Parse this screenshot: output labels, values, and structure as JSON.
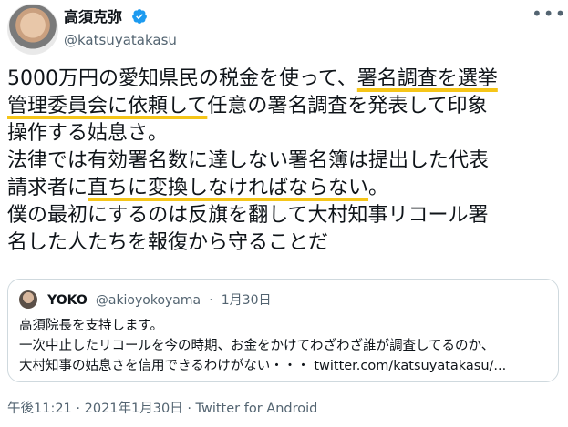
{
  "author": {
    "display_name": "高須克弥",
    "handle": "@katsuyatakasu",
    "verified": true
  },
  "tweet": {
    "lines": [
      [
        {
          "text": "5000万円の愛知県民の税金を使って、",
          "highlight": false
        },
        {
          "text": "署名調査を選挙",
          "highlight": true
        }
      ],
      [
        {
          "text": "管理委員会に依頼して",
          "highlight": true
        },
        {
          "text": "任意の署名調査を発表して印象",
          "highlight": false
        }
      ],
      [
        {
          "text": "操作する姑息さ。",
          "highlight": false
        }
      ],
      [
        {
          "text": "法律では有効署名数に達しない署名簿は提出した代表",
          "highlight": false
        }
      ],
      [
        {
          "text": "請求者に",
          "highlight": false
        },
        {
          "text": "直ちに変換しなければならない",
          "highlight": true
        },
        {
          "text": "。",
          "highlight": false
        }
      ],
      [
        {
          "text": "僕の最初にするのは反旗を翻して大村知事リコール署",
          "highlight": false
        }
      ],
      [
        {
          "text": "名した人たちを報復から守ることだ",
          "highlight": false
        }
      ]
    ]
  },
  "quote": {
    "display_name": "YOKO",
    "handle": "@akioyokoyama",
    "separator": "·",
    "date": "1月30日",
    "lines": [
      "高須院長を支持します。",
      "一次中止したリコールを今の時期、お金をかけてわざわざ誰が調査してるのか、",
      "大村知事の姑息さを信用できるわけがない・・・ twitter.com/katsuyatakasu/..."
    ]
  },
  "footer": {
    "time": "午後11:21",
    "separator": "·",
    "date": "2021年1月30日",
    "source": "Twitter for Android"
  },
  "colors": {
    "verified_badge": "#1d9bf0",
    "highlight_underline": "#f5c518",
    "secondary_text": "#536471",
    "border": "#cfd9de"
  },
  "icons": {
    "verified": "verified-badge-icon",
    "more": "more-options-icon"
  }
}
